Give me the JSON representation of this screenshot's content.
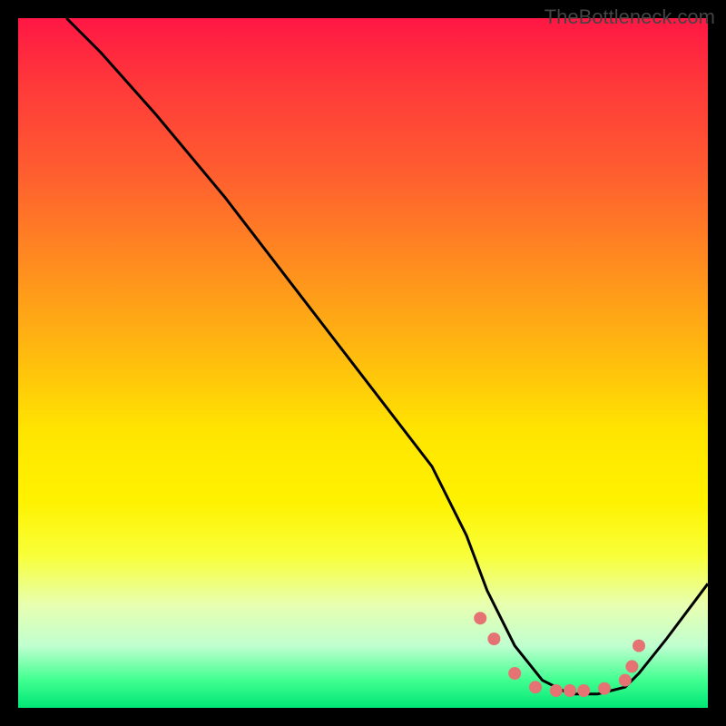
{
  "watermark": "TheBottleneck.com",
  "chart_data": {
    "type": "line",
    "title": "",
    "xlabel": "",
    "ylabel": "",
    "xlim": [
      0,
      100
    ],
    "ylim": [
      0,
      100
    ],
    "series": [
      {
        "name": "curve",
        "x": [
          7,
          12,
          20,
          30,
          40,
          50,
          60,
          65,
          68,
          72,
          76,
          80,
          84,
          88,
          90,
          94,
          100
        ],
        "y": [
          100,
          95,
          86,
          74,
          61,
          48,
          35,
          25,
          17,
          9,
          4,
          2,
          2,
          3,
          5,
          10,
          18
        ]
      }
    ],
    "markers": {
      "name": "dots",
      "x": [
        67,
        69,
        72,
        75,
        78,
        80,
        82,
        85,
        88,
        89,
        90
      ],
      "y": [
        13,
        10,
        5,
        3,
        2.5,
        2.5,
        2.5,
        2.8,
        4,
        6,
        9
      ]
    },
    "colors": {
      "curve": "#000000",
      "marker": "#e57373",
      "background_top": "#ff1744",
      "background_mid": "#ffe500",
      "background_bottom": "#00e676"
    }
  }
}
